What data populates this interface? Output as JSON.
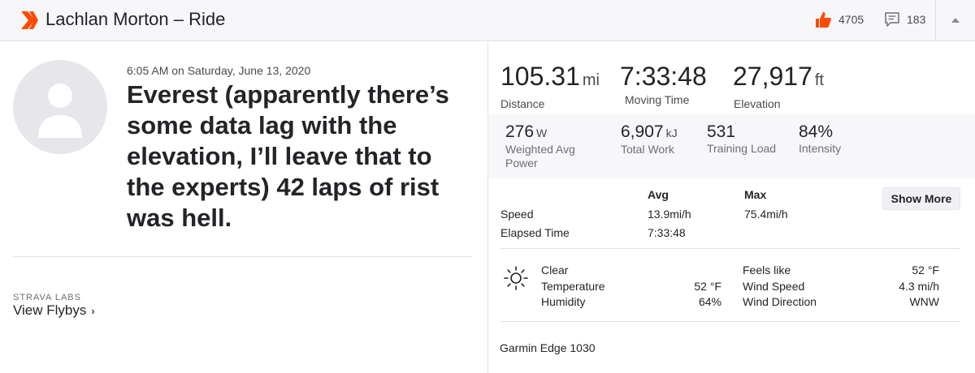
{
  "header": {
    "title": "Lachlan Morton – Ride",
    "kudos_count": "4705",
    "comment_count": "183",
    "brand_color": "#fc4c02",
    "logo_icon": "strava-chevron-logo",
    "kudos_icon": "thumbs-up-icon",
    "comment_icon": "comment-bubble-icon",
    "collapse_icon": "caret-up-icon"
  },
  "activity": {
    "datetime": "6:05 AM on Saturday, June 13, 2020",
    "name": "Everest (apparently there’s some data lag with the elevation, I’ll leave that to the experts) 42 laps of rist was hell.",
    "avatar_icon": "user-avatar-placeholder"
  },
  "labs": {
    "caption": "STRAVA LABS",
    "link": "View Flybys",
    "chevron": "›"
  },
  "primary_stats": [
    {
      "value": "105.31",
      "unit": "mi",
      "label": "Distance"
    },
    {
      "value": "7:33:48",
      "unit": "",
      "label": "Moving Time"
    },
    {
      "value": "27,917",
      "unit": "ft",
      "label": "Elevation"
    }
  ],
  "secondary_stats": [
    {
      "value": "276",
      "unit": "W",
      "label": "Weighted Avg Power"
    },
    {
      "value": "6,907",
      "unit": "kJ",
      "label": "Total Work"
    },
    {
      "value": "531",
      "unit": "",
      "label": "Training Load"
    },
    {
      "value": "84%",
      "unit": "",
      "label": "Intensity"
    }
  ],
  "more_stats": {
    "headers": [
      "Avg",
      "Max"
    ],
    "rows": [
      {
        "label": "Speed",
        "avg": "13.9mi/h",
        "max": "75.4mi/h"
      },
      {
        "label": "Elapsed Time",
        "avg": "7:33:48",
        "max": ""
      }
    ],
    "show_more": "Show More"
  },
  "weather": {
    "icon": "sun-icon",
    "condition": "Clear",
    "temperature_label": "Temperature",
    "temperature": "52 °F",
    "humidity_label": "Humidity",
    "humidity": "64%",
    "feels_like_label": "Feels like",
    "feels_like": "52 °F",
    "wind_speed_label": "Wind Speed",
    "wind_speed": "4.3 mi/h",
    "wind_direction_label": "Wind Direction",
    "wind_direction": "WNW"
  },
  "device": "Garmin Edge 1030"
}
